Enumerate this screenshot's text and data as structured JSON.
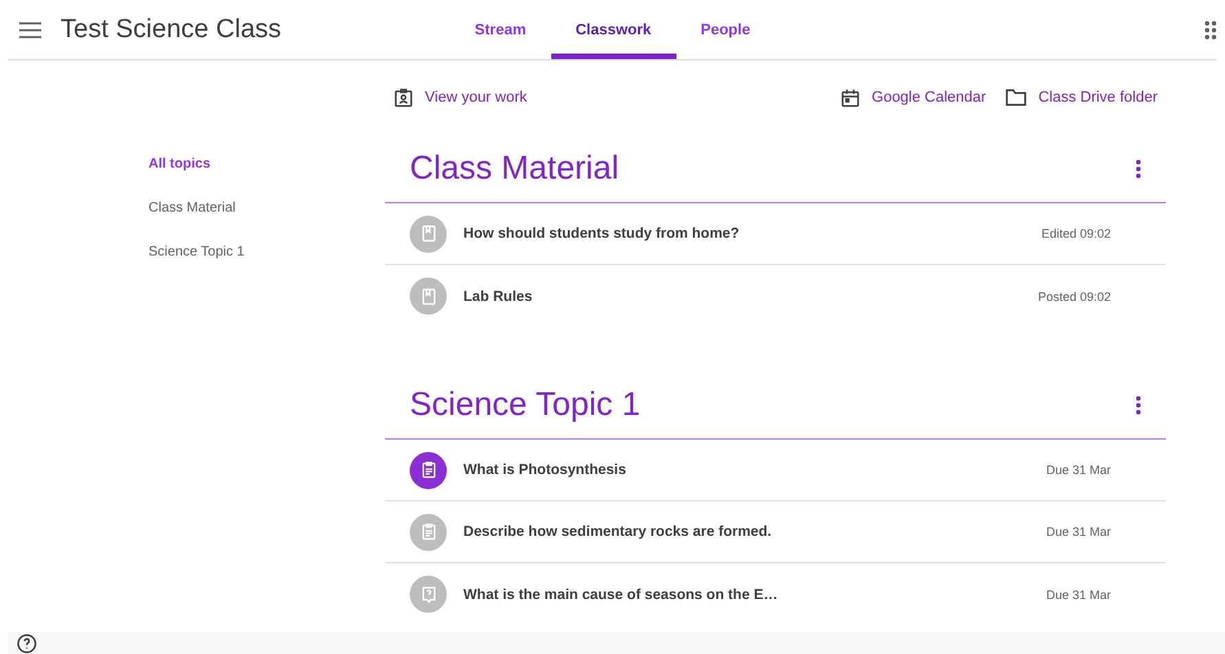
{
  "header": {
    "title": "Test Science Class"
  },
  "tabs": [
    {
      "label": "Stream",
      "selected": false
    },
    {
      "label": "Classwork",
      "selected": true
    },
    {
      "label": "People",
      "selected": false
    }
  ],
  "actions": {
    "view_work": "View your work",
    "calendar": "Google Calendar",
    "drive": "Class Drive folder"
  },
  "sidebar": {
    "items": [
      {
        "label": "All topics",
        "selected": true
      },
      {
        "label": "Class Material",
        "selected": false
      },
      {
        "label": "Science Topic 1",
        "selected": false
      }
    ]
  },
  "topics": [
    {
      "title": "Class Material",
      "items": [
        {
          "kind": "material",
          "title": "How should students study from home?",
          "meta": "Edited 09:02",
          "highlighted": false
        },
        {
          "kind": "material",
          "title": "Lab Rules",
          "meta": "Posted 09:02",
          "highlighted": false
        }
      ]
    },
    {
      "title": "Science Topic 1",
      "items": [
        {
          "kind": "assignment",
          "title": "What is Photosynthesis",
          "meta": "Due 31 Mar",
          "highlighted": true
        },
        {
          "kind": "assignment",
          "title": "Describe how sedimentary rocks are formed.",
          "meta": "Due 31 Mar",
          "highlighted": false
        },
        {
          "kind": "question",
          "title": "What is the main cause of seasons on the E…",
          "meta": "Due 31 Mar",
          "highlighted": false
        }
      ]
    }
  ]
}
